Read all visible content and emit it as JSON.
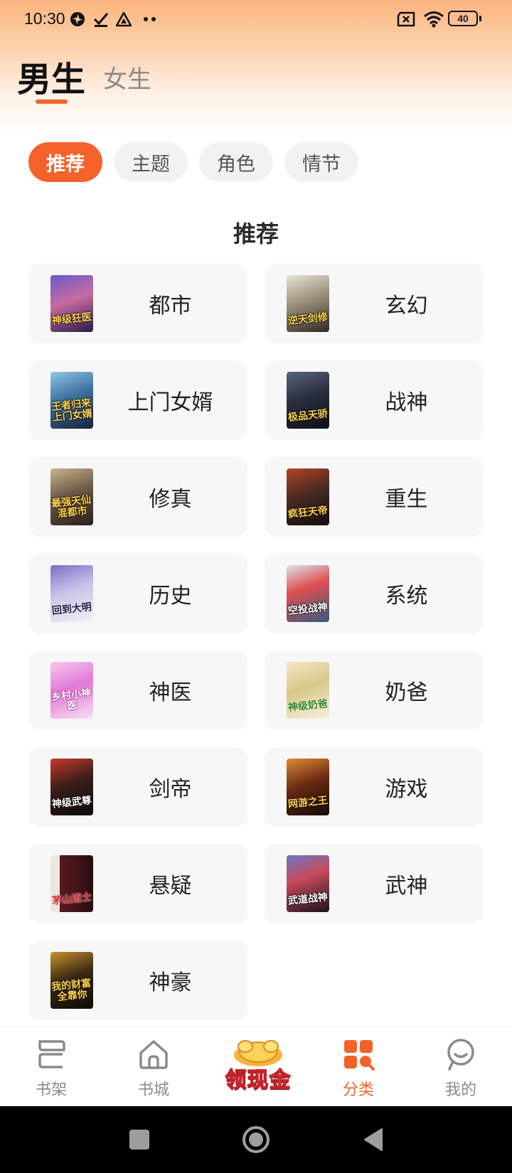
{
  "status_bar": {
    "time": "10:30",
    "battery": "40",
    "left_icons": [
      "pinwheel-icon",
      "check-download-icon",
      "triangle-app-icon",
      "more-dots-icon"
    ],
    "right_icons": [
      "sim-x-icon",
      "wifi-icon",
      "battery-icon"
    ]
  },
  "gender_tabs": [
    {
      "label": "男生",
      "active": true
    },
    {
      "label": "女生",
      "active": false
    }
  ],
  "filter_chips": [
    {
      "label": "推荐",
      "active": true
    },
    {
      "label": "主题",
      "active": false
    },
    {
      "label": "角色",
      "active": false
    },
    {
      "label": "情节",
      "active": false
    }
  ],
  "section_title": "推荐",
  "categories": [
    {
      "label": "都市",
      "cover_text": "神级狂医"
    },
    {
      "label": "玄幻",
      "cover_text": "逆天剑修"
    },
    {
      "label": "上门女婿",
      "cover_text": "王者归来上门女婿"
    },
    {
      "label": "战神",
      "cover_text": "极品天骄"
    },
    {
      "label": "修真",
      "cover_text": "最强天仙混都市"
    },
    {
      "label": "重生",
      "cover_text": "疯狂天帝"
    },
    {
      "label": "历史",
      "cover_text": "回到大明"
    },
    {
      "label": "系统",
      "cover_text": "空投战神"
    },
    {
      "label": "神医",
      "cover_text": "乡村小神医"
    },
    {
      "label": "奶爸",
      "cover_text": "神级奶爸"
    },
    {
      "label": "剑帝",
      "cover_text": "神级武尊"
    },
    {
      "label": "游戏",
      "cover_text": "网游之王"
    },
    {
      "label": "悬疑",
      "cover_text": "茅山道士"
    },
    {
      "label": "武神",
      "cover_text": "武道战神"
    },
    {
      "label": "神豪",
      "cover_text": "我的财富全靠你"
    }
  ],
  "bottom_nav": [
    {
      "label": "书架",
      "icon": "bookshelf-icon",
      "active": false
    },
    {
      "label": "书城",
      "icon": "home-icon",
      "active": false
    },
    {
      "label": "分类",
      "icon": "category-grid-icon",
      "active": true
    },
    {
      "label": "我的",
      "icon": "profile-icon",
      "active": false
    }
  ],
  "promo": {
    "label": "领现金",
    "icon": "gold-coins-icon"
  },
  "system_nav": [
    "recents-square-icon",
    "home-circle-icon",
    "back-triangle-icon"
  ],
  "colors": {
    "accent": "#f4622a",
    "header_gradient_top": "#fbb57e",
    "card_bg": "#f7f7f7",
    "chip_bg": "#f2f2f2",
    "inactive_text": "#8a8a8a"
  }
}
